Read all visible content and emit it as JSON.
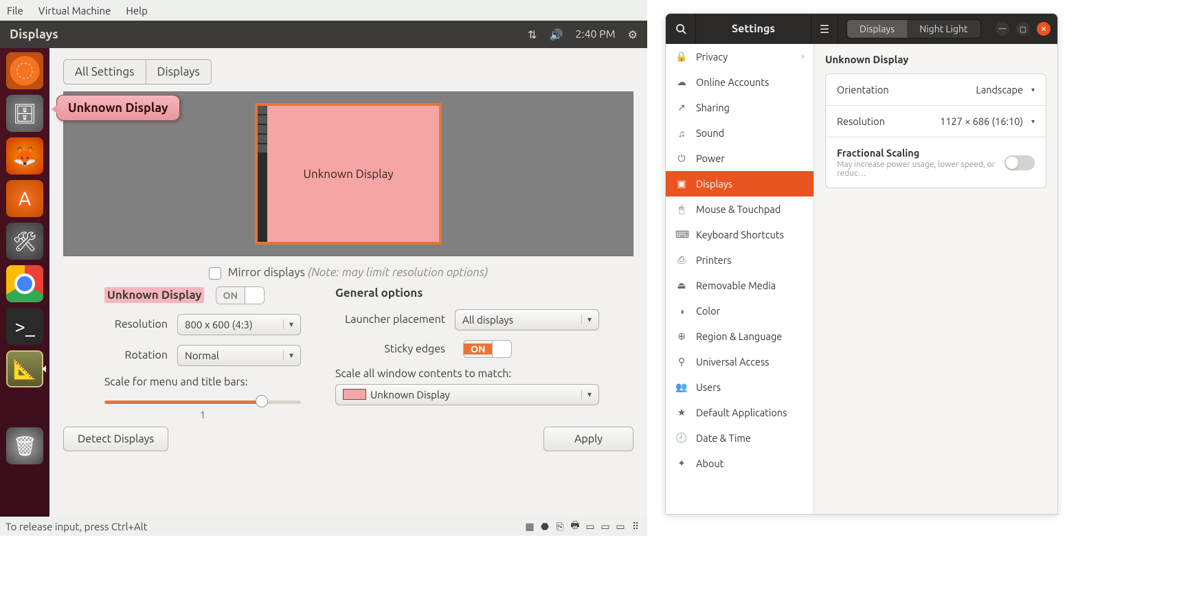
{
  "vm_menu": {
    "file": "File",
    "virtual_machine": "Virtual Machine",
    "help": "Help"
  },
  "vm_titlebar": {
    "title": "Displays",
    "time": "2:40 PM"
  },
  "tooltip": "Unknown Display",
  "tooltip_faded": "Displays",
  "crumbs": {
    "all": "All Settings",
    "disp": "Displays"
  },
  "preview_label": "Unknown Display",
  "mirror": {
    "label": "Mirror displays",
    "note": "(Note: may limit resolution options)"
  },
  "left_col": {
    "heading": "Unknown Display",
    "toggle": "ON",
    "res_label": "Resolution",
    "res_val": "800 x 600 (4:3)",
    "rot_label": "Rotation",
    "rot_val": "Normal",
    "scale_label": "Scale for menu and title bars:",
    "scale_val": "1"
  },
  "right_col": {
    "heading": "General options",
    "launch_label": "Launcher placement",
    "launch_val": "All displays",
    "sticky_label": "Sticky edges",
    "sticky_val": "ON",
    "scale_all": "Scale all window contents to match:",
    "scale_all_val": "Unknown Display"
  },
  "buttons": {
    "detect": "Detect Displays",
    "apply": "Apply"
  },
  "vm_status": "To release input, press Ctrl+Alt",
  "gnome": {
    "title": "Settings",
    "tabs": {
      "displays": "Displays",
      "night": "Night Light"
    },
    "sidebar": [
      {
        "icon": "🔒",
        "label": "Privacy",
        "chev": true
      },
      {
        "icon": "☁",
        "label": "Online Accounts"
      },
      {
        "icon": "↗",
        "label": "Sharing"
      },
      {
        "icon": "♫",
        "label": "Sound"
      },
      {
        "icon": "⏻",
        "label": "Power"
      },
      {
        "icon": "▣",
        "label": "Displays",
        "active": true
      },
      {
        "icon": "🖱",
        "label": "Mouse & Touchpad"
      },
      {
        "icon": "⌨",
        "label": "Keyboard Shortcuts"
      },
      {
        "icon": "⎙",
        "label": "Printers"
      },
      {
        "icon": "⏏",
        "label": "Removable Media"
      },
      {
        "icon": "◑",
        "label": "Color"
      },
      {
        "icon": "⊕",
        "label": "Region & Language"
      },
      {
        "icon": "⚲",
        "label": "Universal Access"
      },
      {
        "icon": "👥",
        "label": "Users"
      },
      {
        "icon": "★",
        "label": "Default Applications"
      },
      {
        "icon": "🕘",
        "label": "Date & Time"
      },
      {
        "icon": "✦",
        "label": "About"
      }
    ],
    "main": {
      "heading": "Unknown Display",
      "rows": {
        "orientation": {
          "label": "Orientation",
          "value": "Landscape"
        },
        "resolution": {
          "label": "Resolution",
          "value": "1127 × 686 (16:10)"
        },
        "fractional": {
          "label": "Fractional Scaling",
          "sub": "May increase power usage, lower speed, or reduc…"
        }
      }
    }
  }
}
